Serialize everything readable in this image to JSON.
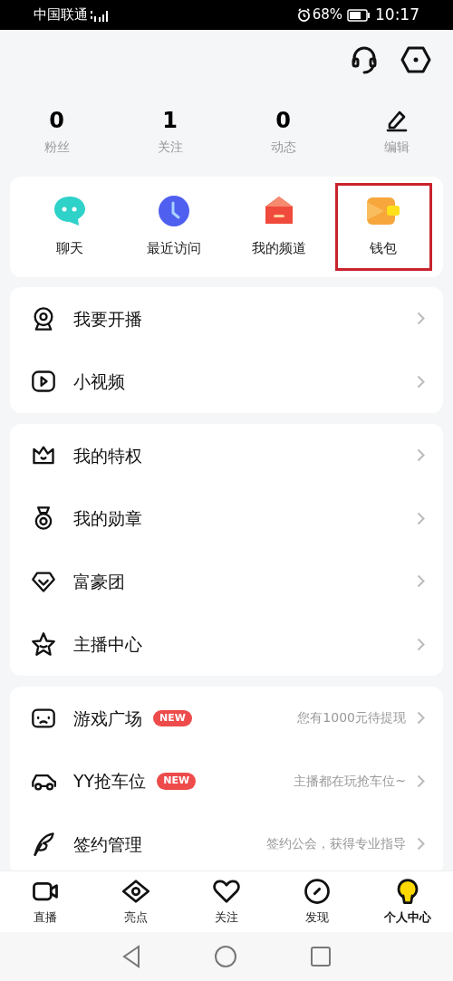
{
  "status_bar": {
    "carrier": "中国联通",
    "battery_percent": "68%",
    "time": "10:17"
  },
  "stats": [
    {
      "value": "0",
      "label": "粉丝"
    },
    {
      "value": "1",
      "label": "关注"
    },
    {
      "value": "0",
      "label": "动态"
    },
    {
      "kind": "edit",
      "label": "编辑"
    }
  ],
  "quick_items": [
    {
      "label": "聊天",
      "highlighted": false
    },
    {
      "label": "最近访问",
      "highlighted": false
    },
    {
      "label": "我的频道",
      "highlighted": false
    },
    {
      "label": "钱包",
      "highlighted": true
    }
  ],
  "menu_groups": [
    [
      {
        "label": "我要开播"
      },
      {
        "label": "小视频"
      }
    ],
    [
      {
        "label": "我的特权"
      },
      {
        "label": "我的勋章"
      },
      {
        "label": "富豪团"
      },
      {
        "label": "主播中心"
      }
    ],
    [
      {
        "label": "游戏广场",
        "badge": "NEW",
        "hint": "您有1000元待提现"
      },
      {
        "label": "YY抢车位",
        "badge": "NEW",
        "hint": "主播都在玩抢车位~"
      },
      {
        "label": "签约管理",
        "hint": "签约公会，获得专业指导"
      }
    ]
  ],
  "bottom_nav": [
    {
      "label": "直播",
      "selected": false
    },
    {
      "label": "亮点",
      "selected": false
    },
    {
      "label": "关注",
      "selected": false
    },
    {
      "label": "发现",
      "selected": false
    },
    {
      "label": "个人中心",
      "selected": true
    }
  ]
}
